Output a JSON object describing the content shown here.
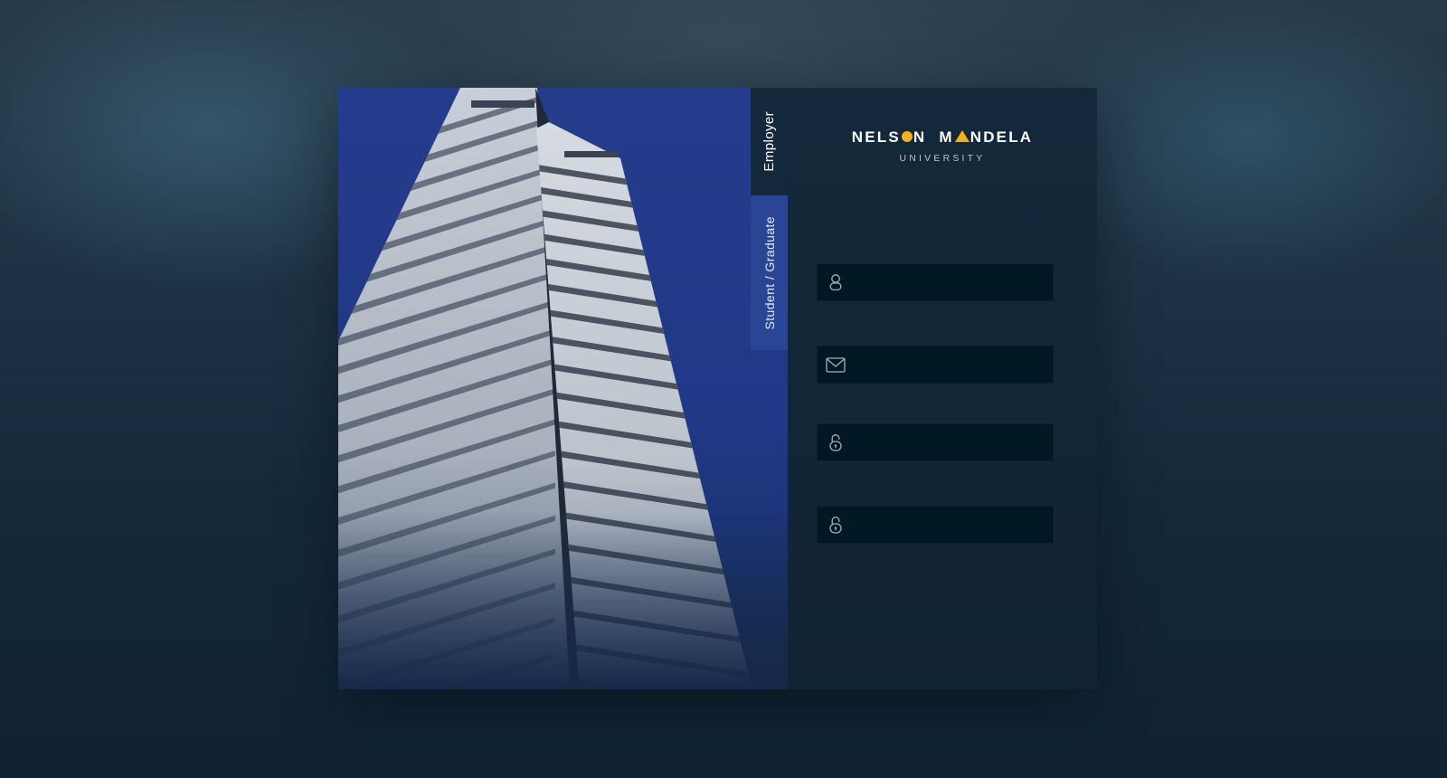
{
  "tabs": {
    "employer": "Employer",
    "student": "Student / Graduate"
  },
  "logo": {
    "word1_a": "NELS",
    "word1_b": "N",
    "word2_a": "M",
    "word2_b": "NDELA",
    "subtitle": "UNIVERSITY",
    "accent_color": "#f2b21d"
  },
  "form": {
    "fields": [
      {
        "name": "username",
        "icon": "user-icon",
        "value": "",
        "placeholder": ""
      },
      {
        "name": "email",
        "icon": "envelope-icon",
        "value": "",
        "placeholder": ""
      },
      {
        "name": "password",
        "icon": "lock-icon",
        "value": "",
        "placeholder": ""
      },
      {
        "name": "confirm-password",
        "icon": "lock-icon",
        "value": "",
        "placeholder": ""
      }
    ]
  },
  "colors": {
    "background": "#1d3345",
    "panel": "#13283a",
    "input": "#001724",
    "sky": "#253c8c",
    "active_tab": "#15293c",
    "inactive_tab": "#2c4696"
  }
}
